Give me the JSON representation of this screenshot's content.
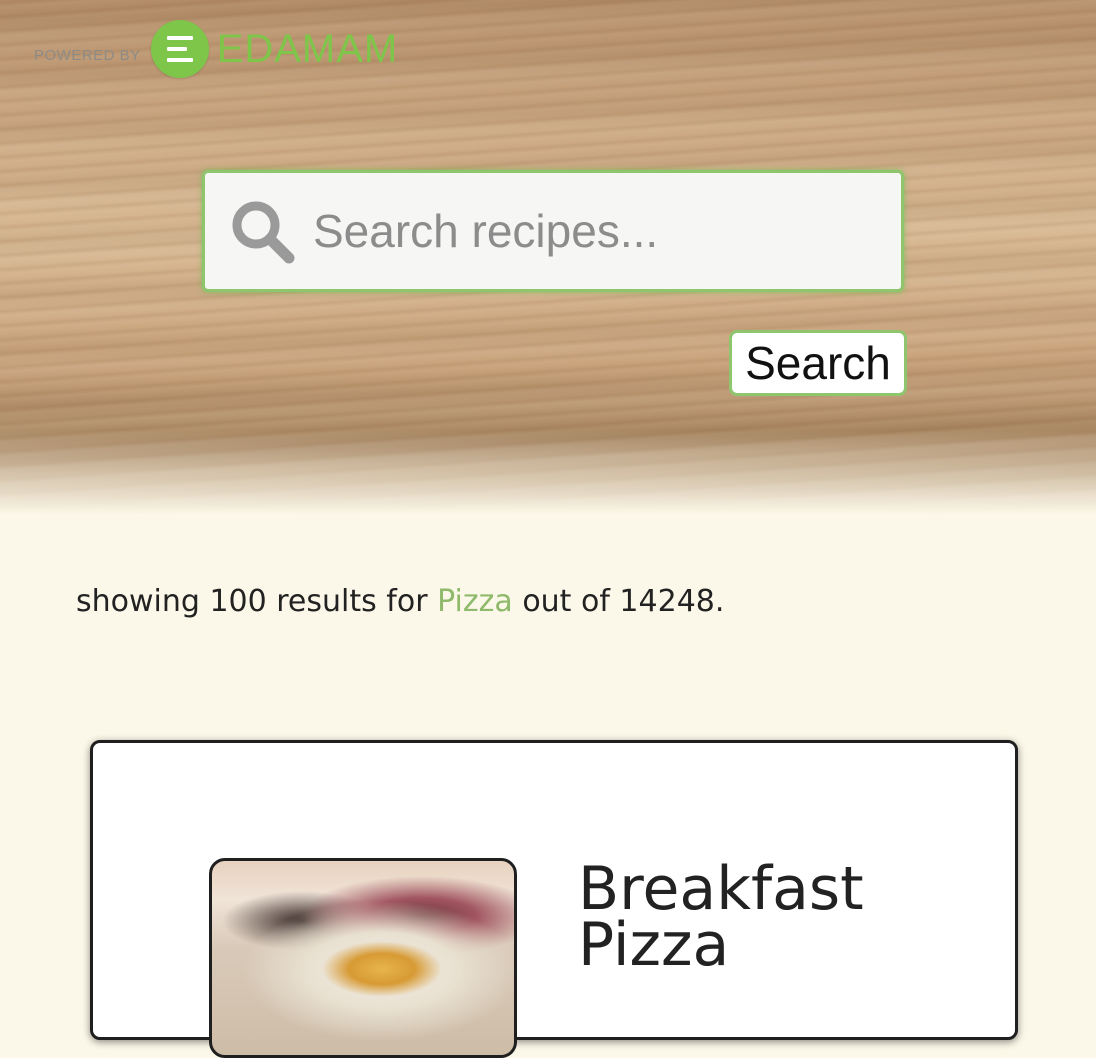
{
  "header": {
    "powered_by": "POWERED BY",
    "brand": "EDAMAM",
    "brand_color": "#7ec64a"
  },
  "search": {
    "placeholder": "Search recipes...",
    "value": "",
    "button_label": "Search",
    "accent_color": "#8fc56c",
    "icon": "search-icon"
  },
  "results": {
    "prefix": "showing 100 results for",
    "query": "Pizza",
    "suffix": "out of 14248."
  },
  "recipes": [
    {
      "title": "Breakfast Pizza",
      "image_icon": "recipe-photo"
    }
  ]
}
